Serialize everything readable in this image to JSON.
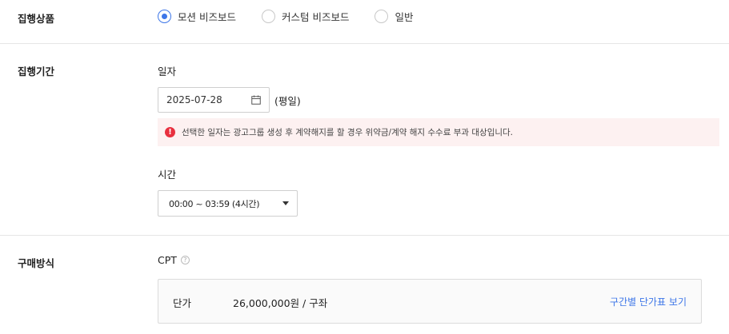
{
  "sections": {
    "product_label": "집행상품",
    "period_label": "집행기간",
    "purchase_label": "구매방식"
  },
  "product": {
    "options": [
      {
        "label": "모션 비즈보드",
        "checked": true
      },
      {
        "label": "커스텀 비즈보드",
        "checked": false
      },
      {
        "label": "일반",
        "checked": false
      }
    ]
  },
  "period": {
    "date_label": "일자",
    "date_value": "2025-07-28",
    "weekday": "(평일)",
    "notice": "선택한 일자는 광고그룹 생성 후 계약해지를 할 경우 위약금/계약 해지 수수료 부과 대상입니다.",
    "time_label": "시간",
    "time_value": "00:00 ~ 03:59 (4시간)"
  },
  "purchase": {
    "method": "CPT",
    "price_label": "단가",
    "price_value": "26,000,000원 / 구좌",
    "price_table_link": "구간별 단가표 보기"
  },
  "colors": {
    "accent": "#3d76e8",
    "warning": "#e8303f",
    "notice_bg": "#fdf1f1"
  },
  "icons": [
    "calendar-icon",
    "warning-icon",
    "help-icon",
    "chevron-down-icon"
  ]
}
